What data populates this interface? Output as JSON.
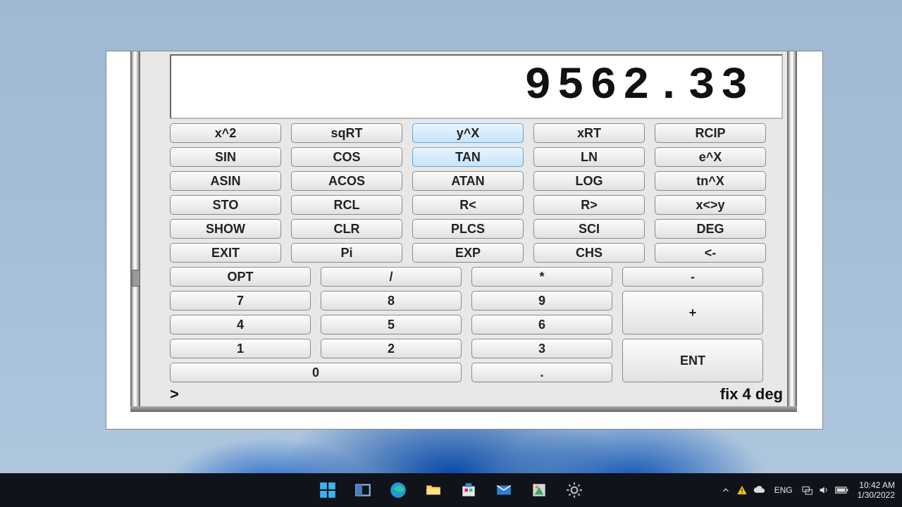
{
  "display": "9562.33",
  "fn": {
    "r1": [
      "x^2",
      "sqRT",
      "y^X",
      "xRT",
      "RCIP"
    ],
    "r2": [
      "SIN",
      "COS",
      "TAN",
      "LN",
      "e^X"
    ],
    "r3": [
      "ASIN",
      "ACOS",
      "ATAN",
      "LOG",
      "tn^X"
    ],
    "r4": [
      "STO",
      "RCL",
      "R<",
      "R>",
      "x<>y"
    ],
    "r5": [
      "SHOW",
      "CLR",
      "PLCS",
      "SCI",
      "DEG"
    ],
    "r6": [
      "EXIT",
      "Pi",
      "EXP",
      "CHS",
      "<-"
    ]
  },
  "highlighted": [
    "y^X",
    "TAN"
  ],
  "num": {
    "opt": "OPT",
    "div": "/",
    "mul": "*",
    "minus": "-",
    "7": "7",
    "8": "8",
    "9": "9",
    "4": "4",
    "5": "5",
    "6": "6",
    "1": "1",
    "2": "2",
    "3": "3",
    "0": "0",
    "dot": ".",
    "plus": "+",
    "ent": "ENT"
  },
  "status": {
    "prompt": ">",
    "mode": "fix 4 deg"
  },
  "taskbar": {
    "lang": "ENG",
    "time": "10:42 AM",
    "date": "1/30/2022"
  }
}
